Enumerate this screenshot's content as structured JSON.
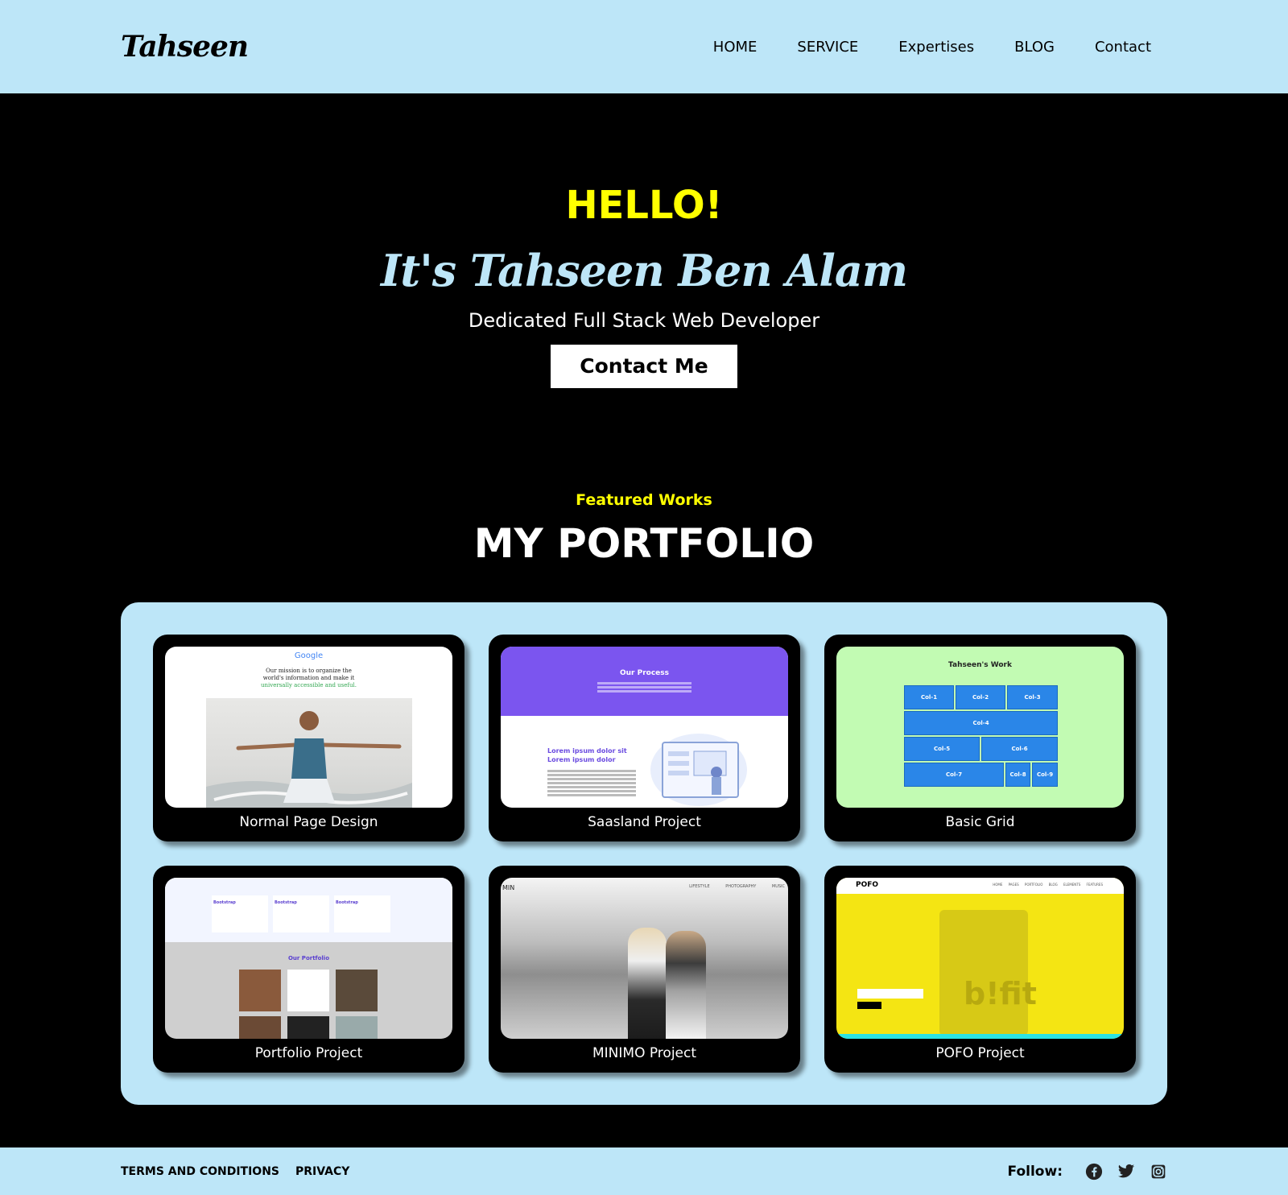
{
  "header": {
    "logo": "Tahseen",
    "nav": [
      "HOME",
      "SERVICE",
      "Expertises",
      "BLOG",
      "Contact"
    ]
  },
  "hero": {
    "hello": "HELLO!",
    "name": "It's Tahseen Ben Alam",
    "tagline": "Dedicated Full Stack Web Developer",
    "cta": "Contact Me"
  },
  "portfolio": {
    "subtitle": "Featured Works",
    "title": "MY PORTFOLIO",
    "items": [
      {
        "title": "Normal Page Design"
      },
      {
        "title": "Saasland Project"
      },
      {
        "title": "Basic Grid"
      },
      {
        "title": "Portfolio Project"
      },
      {
        "title": "MINIMO Project"
      },
      {
        "title": "POFO Project"
      }
    ],
    "thumb_text": {
      "google": "Google",
      "mission_1": "Our mission is to organize the",
      "mission_2": "world's information and make it",
      "mission_3": "universally accessible and useful.",
      "process": "Our Process",
      "lorem": "Lorem ipsum dolor sit",
      "lorem2": "Lorem ipsum dolor",
      "grid_title": "Tahseen's Work",
      "grid_cols": [
        "Col-1",
        "Col-2",
        "Col-3",
        "Col-4",
        "Col-5",
        "Col-6",
        "Col-7",
        "Col-8",
        "Col-9"
      ],
      "bootstrap": "Bootstrap",
      "our_portfolio": "Our Portfolio",
      "minimo_logo": "MIN",
      "minimo_nav": "LIFESTYLE PHOTOGRAPHY MUSIC",
      "pofo_logo": "POFO",
      "pofo_nav": "HOME PAGES PORTFOLIO BLOG ELEMENTS FEATURES",
      "pofo_brand": "b!fit"
    }
  },
  "footer": {
    "links": [
      "TERMS AND CONDITIONS",
      "PRIVACY"
    ],
    "follow": "Follow:",
    "social_icons": [
      "facebook-icon",
      "twitter-icon",
      "instagram-icon"
    ]
  },
  "colors": {
    "accent_light_blue": "#bde6f8",
    "accent_yellow": "#ffff00",
    "background": "#000000"
  }
}
